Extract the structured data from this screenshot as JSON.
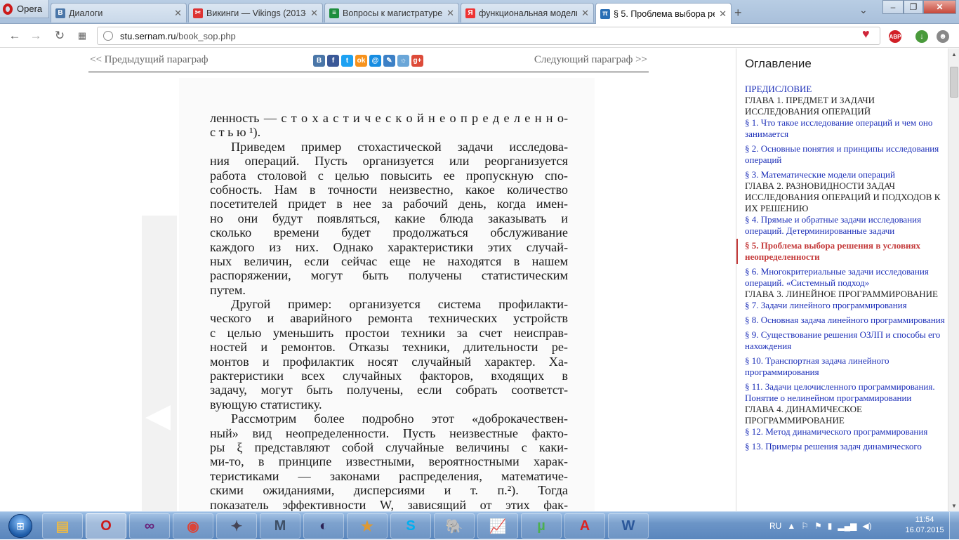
{
  "browser": {
    "menu_label": "Opera",
    "tabs": [
      {
        "title": "Диалоги",
        "favicon": "vk-icon",
        "color": "#4a76a8",
        "glyph": "В",
        "active": false
      },
      {
        "title": "Викинги — Vikings (2013– …",
        "favicon": "series-icon",
        "color": "#d33",
        "glyph": "✂",
        "active": false
      },
      {
        "title": "Вопросы к магистратуре",
        "favicon": "sheets-icon",
        "color": "#1e8e3e",
        "glyph": "≡",
        "active": false
      },
      {
        "title": "функциональная модель",
        "favicon": "yandex-icon",
        "color": "#e33",
        "glyph": "Я",
        "active": false
      },
      {
        "title": "§ 5. Проблема выбора ре…",
        "favicon": "pi-icon",
        "color": "#2a6fb5",
        "glyph": "π",
        "active": true
      }
    ],
    "url_host": "stu.sernam.ru",
    "url_path": "/book_sop.php",
    "ext_abp": "ABP"
  },
  "page": {
    "prev_link": "<< Предыдущий параграф",
    "next_link": "Следующий параграф >>",
    "share_icons": [
      {
        "name": "vkontakte-share-icon",
        "glyph": "B",
        "color": "#4a76a8"
      },
      {
        "name": "facebook-share-icon",
        "glyph": "f",
        "color": "#3b5998"
      },
      {
        "name": "twitter-share-icon",
        "glyph": "t",
        "color": "#1da1f2"
      },
      {
        "name": "odnoklassniki-share-icon",
        "glyph": "ok",
        "color": "#f7931e"
      },
      {
        "name": "mailru-share-icon",
        "glyph": "@",
        "color": "#168de2"
      },
      {
        "name": "livejournal-share-icon",
        "glyph": "✎",
        "color": "#3c80c6"
      },
      {
        "name": "yaru-share-icon",
        "glyph": "☼",
        "color": "#6aa6d8"
      },
      {
        "name": "googleplus-share-icon",
        "glyph": "g+",
        "color": "#dd4b39"
      }
    ],
    "scan_lines": [
      {
        "text": "ленность — с т о х а с т и ч е с к о й   н е о п р е д е л е н н о-",
        "indent": false,
        "last": false
      },
      {
        "text": "с т ь ю ¹).",
        "indent": false,
        "last": true
      },
      {
        "text": "Приведем пример стохастической задачи исследова-",
        "indent": true,
        "last": false
      },
      {
        "text": "ния операций. Пусть организуется или реорганизуется",
        "indent": false,
        "last": false
      },
      {
        "text": "работа столовой с целью повысить ее пропускную спо-",
        "indent": false,
        "last": false
      },
      {
        "text": "собность. Нам в точности неизвестно, какое количество",
        "indent": false,
        "last": false
      },
      {
        "text": "посетителей придет в нее за рабочий день, когда имен-",
        "indent": false,
        "last": false
      },
      {
        "text": "но они будут появляться, какие блюда заказывать и",
        "indent": false,
        "last": false
      },
      {
        "text": "сколько времени будет продолжаться обслуживание",
        "indent": false,
        "last": false
      },
      {
        "text": "каждого из них. Однако характеристики этих случай-",
        "indent": false,
        "last": false
      },
      {
        "text": "ных величин, если сейчас еще не находятся в нашем",
        "indent": false,
        "last": false
      },
      {
        "text": "распоряжении, могут быть получены статистическим",
        "indent": false,
        "last": false
      },
      {
        "text": "путем.",
        "indent": false,
        "last": true
      },
      {
        "text": "Другой пример: организуется система профилакти-",
        "indent": true,
        "last": false
      },
      {
        "text": "ческого и аварийного ремонта технических устройств",
        "indent": false,
        "last": false
      },
      {
        "text": "с целью уменьшить простои техники за счет неисправ-",
        "indent": false,
        "last": false
      },
      {
        "text": "ностей и ремонтов. Отказы техники, длительности ре-",
        "indent": false,
        "last": false
      },
      {
        "text": "монтов и профилактик носят случайный характер. Ха-",
        "indent": false,
        "last": false
      },
      {
        "text": "рактеристики всех случайных факторов, входящих в",
        "indent": false,
        "last": false
      },
      {
        "text": "задачу, могут быть получены, если собрать соответст-",
        "indent": false,
        "last": false
      },
      {
        "text": "вующую статистику.",
        "indent": false,
        "last": true
      },
      {
        "text": "Рассмотрим более подробно этот «доброкачествен-",
        "indent": true,
        "last": false
      },
      {
        "text": "ный» вид неопределенности. Пусть неизвестные факто-",
        "indent": false,
        "last": false
      },
      {
        "text": "ры ξ представляют собой случайные величины с каки-",
        "indent": false,
        "last": false
      },
      {
        "text": "ми-то, в принципе известными, вероятностными харак-",
        "indent": false,
        "last": false
      },
      {
        "text": "теристиками — законами распределения, математиче-",
        "indent": false,
        "last": false
      },
      {
        "text": "скими ожиданиями, дисперсиями и т. п.²). Тогда",
        "indent": false,
        "last": false
      },
      {
        "text": "показатель эффективности W, зависящий от этих фак-",
        "indent": false,
        "last": false
      }
    ]
  },
  "toc": {
    "title": "Оглавление",
    "items": [
      {
        "text": "ПРЕДИСЛОВИЕ",
        "kind": "link tight"
      },
      {
        "text": "ГЛАВА 1. ПРЕДМЕТ И ЗАДАЧИ ИССЛЕДОВАНИЯ ОПЕРАЦИЙ",
        "kind": "chapter"
      },
      {
        "text": "§ 1. Что такое исследование операций и чем оно занимается",
        "kind": "link"
      },
      {
        "text": "§ 2. Основные понятия и принципы исследования операций",
        "kind": "link"
      },
      {
        "text": "§ 3. Математические модели операций",
        "kind": "link tight"
      },
      {
        "text": "ГЛАВА 2. РАЗНОВИДНОСТИ ЗАДАЧ ИССЛЕДОВАНИЯ ОПЕРАЦИЙ И ПОДХОДОВ К ИХ РЕШЕНИЮ",
        "kind": "chapter"
      },
      {
        "text": "§ 4. Прямые и обратные задачи исследования операций. Детерминированные задачи",
        "kind": "link"
      },
      {
        "text": "§ 5. Проблема выбора решения в условиях неопределенности",
        "kind": "current"
      },
      {
        "text": "§ 6. Многокритериальные задачи исследования операций. «Системный подход»",
        "kind": "link tight"
      },
      {
        "text": "ГЛАВА 3. ЛИНЕЙНОЕ ПРОГРАММИРОВАНИЕ",
        "kind": "chapter"
      },
      {
        "text": "§ 7. Задачи линейного программирования",
        "kind": "link"
      },
      {
        "text": "§ 8. Основная задача линейного программирования",
        "kind": "link"
      },
      {
        "text": "§ 9. Существование решения ОЗЛП и способы его нахождения",
        "kind": "link"
      },
      {
        "text": "§ 10. Транспортная задача линейного программирования",
        "kind": "link"
      },
      {
        "text": "§ 11. Задачи целочисленного программирования. Понятие о нелинейном программировании",
        "kind": "link tight"
      },
      {
        "text": "ГЛАВА 4. ДИНАМИЧЕСКОЕ ПРОГРАММИРОВАНИЕ",
        "kind": "chapter"
      },
      {
        "text": "§ 12. Метод динамического программирования",
        "kind": "link"
      },
      {
        "text": "§ 13. Примеры решения задач динамического",
        "kind": "link"
      }
    ]
  },
  "taskbar": {
    "apps": [
      {
        "name": "explorer-taskbar-icon",
        "glyph": "▤",
        "color": "#e8b84a"
      },
      {
        "name": "opera-taskbar-icon",
        "glyph": "O",
        "color": "#cc1a1a",
        "active": true
      },
      {
        "name": "visual-studio-taskbar-icon",
        "glyph": "∞",
        "color": "#68217a"
      },
      {
        "name": "chrome-taskbar-icon",
        "glyph": "◉",
        "color": "#db4437"
      },
      {
        "name": "satellite-app-taskbar-icon",
        "glyph": "✦",
        "color": "#445"
      },
      {
        "name": "m-app-taskbar-icon",
        "glyph": "M",
        "color": "#3d4f66"
      },
      {
        "name": "eclipse-taskbar-icon",
        "glyph": "◐",
        "color": "#2c2255"
      },
      {
        "name": "star-app-taskbar-icon",
        "glyph": "★",
        "color": "#d93"
      },
      {
        "name": "skype-taskbar-icon",
        "glyph": "S",
        "color": "#00aff0"
      },
      {
        "name": "postgresql-taskbar-icon",
        "glyph": "🐘",
        "color": "#336791"
      },
      {
        "name": "chart-app-taskbar-icon",
        "glyph": "📈",
        "color": "#3a3"
      },
      {
        "name": "utorrent-taskbar-icon",
        "glyph": "µ",
        "color": "#4caf50"
      },
      {
        "name": "acrobat-taskbar-icon",
        "glyph": "A",
        "color": "#d22"
      },
      {
        "name": "word-taskbar-icon",
        "glyph": "W",
        "color": "#2b579a"
      }
    ],
    "lang": "RU",
    "time": "11:54",
    "date": "16.07.2015"
  }
}
